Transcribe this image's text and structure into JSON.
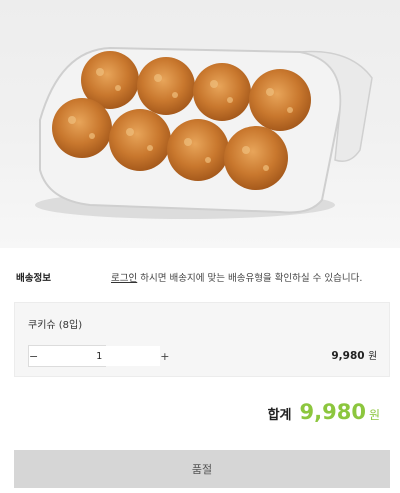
{
  "product_image": {
    "alt": "쿠키슈 8입 상품 이미지"
  },
  "shipping": {
    "label": "배송정보",
    "login_link": "로그인",
    "message": " 하시면 배송지에 맞는 배송유형을 확인하실 수 있습니다."
  },
  "option": {
    "name": "쿠키슈 (8입)",
    "quantity": "1",
    "minus": "−",
    "plus": "+",
    "price": "9,980",
    "currency": "원"
  },
  "total": {
    "label": "합계",
    "amount": "9,980",
    "currency": "원",
    "accent_color": "#8cc63e"
  },
  "buy_button": {
    "label": "품절"
  }
}
